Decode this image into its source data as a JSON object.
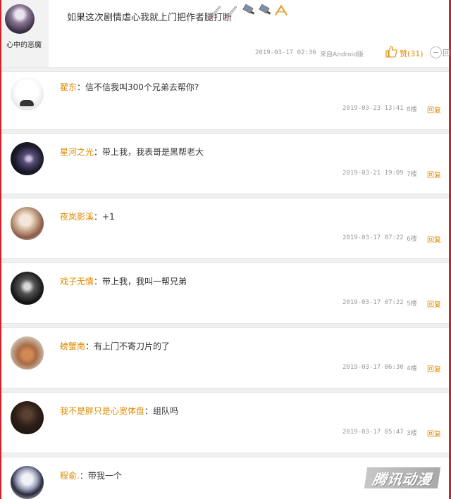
{
  "top_comment": {
    "username": "心中的恶魔",
    "text": "如果这次剧情虐心我就上门把作者腿打断",
    "emojis": [
      "knife-emoji",
      "knife-emoji",
      "cleaver-emoji",
      "cleaver-emoji",
      "pincer-emoji"
    ],
    "time": "2019-03-17 02:36",
    "source": "来自Android版",
    "like_label": "赞(31)",
    "reply_label": "回"
  },
  "replies": [
    {
      "name": "翟东",
      "text": "：信不信我叫300个兄弟去帮你?",
      "time": "2019-03-23 13:41",
      "floor": "8楼",
      "reply": "回复"
    },
    {
      "name": "星河之光",
      "text": "：带上我，我表哥是黑帮老大",
      "time": "2019-03-21 19:09",
      "floor": "7楼",
      "reply": "回复"
    },
    {
      "name": "夜岚影溪",
      "text": "：+1",
      "time": "2019-03-17 07:22",
      "floor": "6楼",
      "reply": "回复"
    },
    {
      "name": "戏子无情",
      "text": "：带上我，我叫一帮兄弟",
      "time": "2019-03-17 07:22",
      "floor": "5楼",
      "reply": "回复"
    },
    {
      "name": "螃蟹南",
      "text": "：有上门不寄刀片的了",
      "time": "2019-03-17 06:30",
      "floor": "4楼",
      "reply": "回复"
    },
    {
      "name": "我不是胖只是心宽体盘",
      "text": "：组队吗",
      "time": "2019-03-17 05:47",
      "floor": "3楼",
      "reply": "回复"
    },
    {
      "name": "程俞.",
      "text": "：带我一个",
      "time": "",
      "floor": "",
      "reply": ""
    }
  ],
  "watermark": "腾讯动漫",
  "colors": {
    "accent": "#e08a00",
    "frame": "#d71f27",
    "meta": "#999999"
  }
}
